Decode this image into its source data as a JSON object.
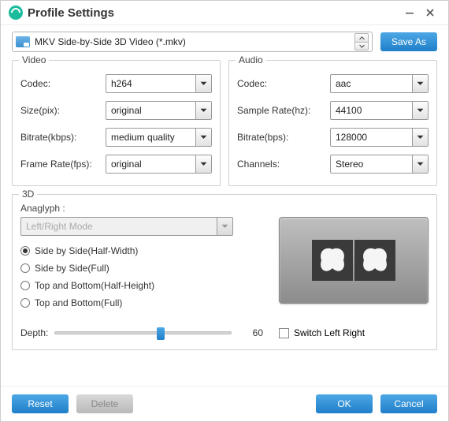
{
  "window": {
    "title": "Profile Settings"
  },
  "profile": {
    "selected": "MKV Side-by-Side 3D Video (*.mkv)",
    "save_as": "Save As"
  },
  "video": {
    "legend": "Video",
    "codec_label": "Codec:",
    "codec_value": "h264",
    "size_label": "Size(pix):",
    "size_value": "original",
    "bitrate_label": "Bitrate(kbps):",
    "bitrate_value": "medium quality",
    "fps_label": "Frame Rate(fps):",
    "fps_value": "original"
  },
  "audio": {
    "legend": "Audio",
    "codec_label": "Codec:",
    "codec_value": "aac",
    "sr_label": "Sample Rate(hz):",
    "sr_value": "44100",
    "bitrate_label": "Bitrate(bps):",
    "bitrate_value": "128000",
    "ch_label": "Channels:",
    "ch_value": "Stereo"
  },
  "threeD": {
    "legend": "3D",
    "anaglyph_label": "Anaglyph :",
    "anaglyph_value": "Left/Right Mode",
    "radios": {
      "sbs_half": "Side by Side(Half-Width)",
      "sbs_full": "Side by Side(Full)",
      "tab_half": "Top and Bottom(Half-Height)",
      "tab_full": "Top and Bottom(Full)"
    },
    "depth_label": "Depth:",
    "depth_value": "60",
    "switch_label": "Switch Left Right"
  },
  "buttons": {
    "reset": "Reset",
    "delete": "Delete",
    "ok": "OK",
    "cancel": "Cancel"
  }
}
